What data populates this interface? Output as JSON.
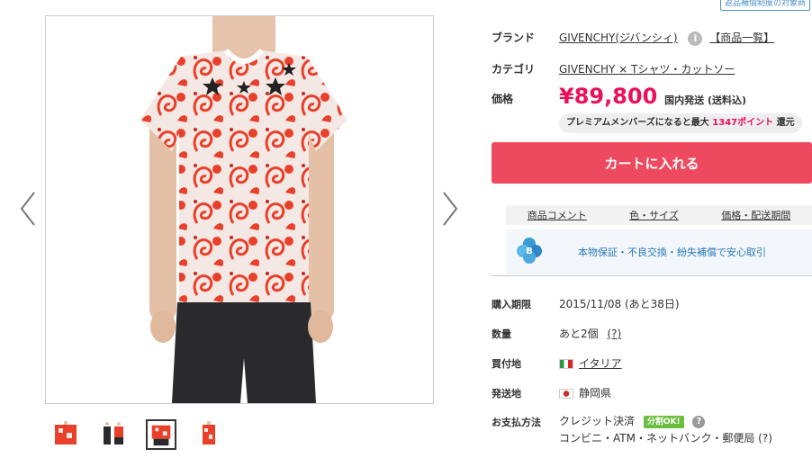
{
  "corner_tag": "返品補償制度の対象商",
  "product": {
    "brand_label": "ブランド",
    "brand_value": "GIVENCHY(ジバンシィ)",
    "brand_list_link": "【商品一覧】",
    "category_label": "カテゴリ",
    "category_value": "GIVENCHY × Tシャツ・カットソー",
    "price_label": "価格",
    "price": "¥89,800",
    "shipping": "国内発送 (送料込)",
    "premium_prefix": "プレミアムメンバーズになると最大",
    "premium_points": "1347ポイント",
    "premium_suffix": "還元",
    "cart_button": "カートに入れる"
  },
  "tabs": [
    "商品コメント",
    "色・サイズ",
    "価格・配送期間"
  ],
  "assurance_text": "本物保証・不良交換・紛失補償で安心取引",
  "details": {
    "purchase_deadline_label": "購入期限",
    "purchase_deadline_value": "2015/11/08 (あと38日)",
    "quantity_label": "数量",
    "quantity_value": "あと2個",
    "quantity_help": "(?)",
    "buy_location_label": "買付地",
    "buy_location_value": "イタリア",
    "ship_from_label": "発送地",
    "ship_from_value": "静岡県",
    "payment_label": "お支払方法",
    "payment_credit": "クレジット決済",
    "payment_ok_badge": "分割OK!",
    "payment_help": "?",
    "payment_other": "コンビニ・ATM・ネットバンク・郵便局 (?)"
  },
  "colors": {
    "price": "#e8115a",
    "cart_button": "#ee4a5f",
    "shirt_red": "#e8402a",
    "shorts": "#2a2a2e",
    "assurance_text": "#2a7ab8",
    "ok_badge": "#6abf3e"
  },
  "icons": [
    "chevron-left-icon",
    "chevron-right-icon",
    "info-icon",
    "buyma-clover-logo",
    "help-icon"
  ]
}
